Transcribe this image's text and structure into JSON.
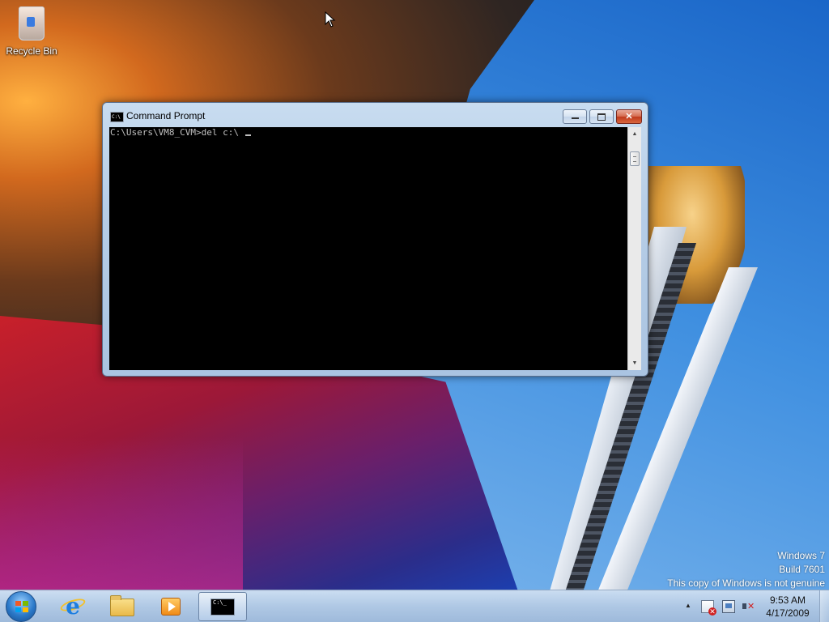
{
  "desktop": {
    "icons": [
      {
        "label": "Recycle Bin",
        "icon": "recycle-bin-icon"
      }
    ]
  },
  "window": {
    "title": "Command Prompt",
    "icon": "cmd-icon",
    "console_text": "C:\\Users\\VM8_CVM>del c:\\ ",
    "buttons": {
      "minimize": "minimize-icon",
      "maximize": "maximize-icon",
      "close": "✕"
    }
  },
  "watermark": {
    "line1": "Windows 7",
    "line2": "Build 7601",
    "line3": "This copy of Windows is not genuine"
  },
  "taskbar": {
    "start": "start-orb-icon",
    "pinned": [
      {
        "name": "Internet Explorer",
        "icon": "internet-explorer-icon"
      },
      {
        "name": "Windows Explorer",
        "icon": "folder-icon"
      },
      {
        "name": "Windows Media Player",
        "icon": "media-player-icon"
      },
      {
        "name": "Command Prompt",
        "icon": "cmd-icon",
        "active": true
      }
    ],
    "tray": {
      "icons": [
        "action-center-flag-icon",
        "network-icon",
        "volume-muted-icon"
      ],
      "time": "9:53 AM",
      "date": "4/17/2009"
    }
  },
  "colors": {
    "console_bg": "#000000",
    "console_fg": "#c0c0c0",
    "close_button": "#c0391c"
  }
}
